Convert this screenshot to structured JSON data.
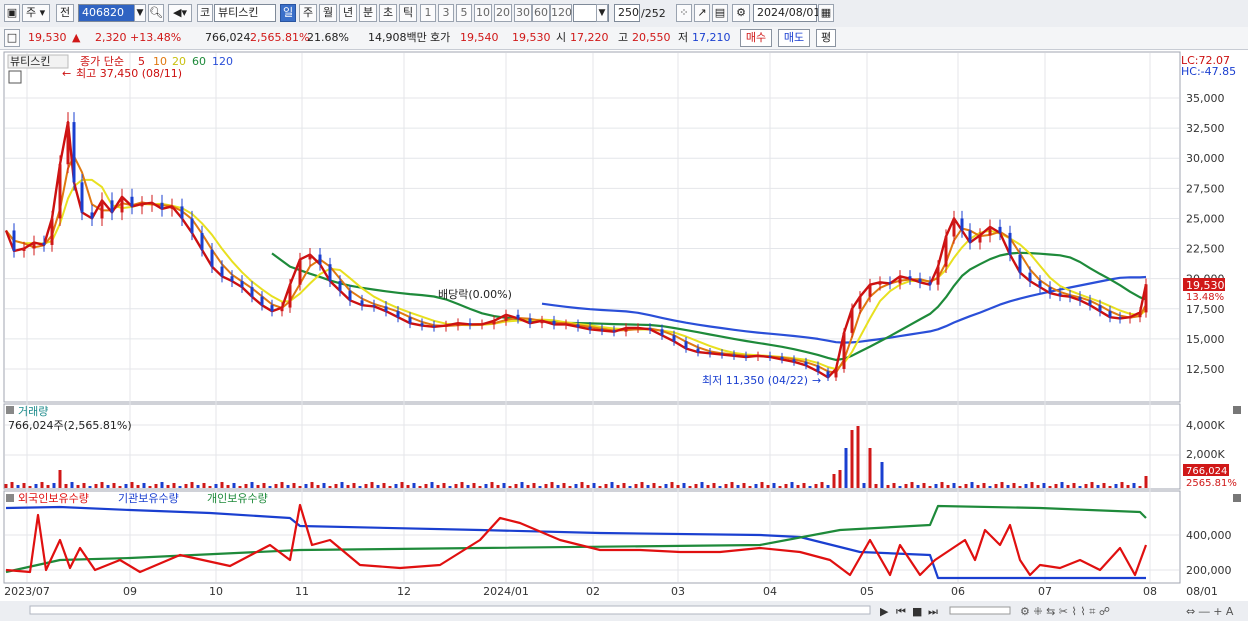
{
  "toolbar": {
    "menu_left": "주",
    "prev_label": "전",
    "stock_code": "406820",
    "stock_name": "뷰티스킨",
    "code_prefix": "코",
    "periods": [
      "일",
      "주",
      "월",
      "년",
      "분",
      "초",
      "틱"
    ],
    "active_period": "일",
    "intervals": [
      "1",
      "3",
      "5",
      "10",
      "20",
      "30",
      "60",
      "120"
    ],
    "count_value": "250",
    "count_total": "/252",
    "date_value": "2024/08/01"
  },
  "quote": {
    "price": "19,530",
    "arrow": "▲",
    "change": "2,320",
    "change_pct": "+13.48%",
    "volume": "766,024",
    "vol_ratio": "2,565.81%",
    "turnover": "21.68%",
    "amount": "14,908백만",
    "hoga_label": "호가",
    "bid1": "19,540",
    "bid2": "19,530",
    "open_label": "시",
    "open": "17,220",
    "high_label": "고",
    "high": "20,550",
    "low_label": "저",
    "low": "17,210",
    "buy_button": "매수",
    "sell_button": "매도",
    "eval_button": "평"
  },
  "price_panel": {
    "title": "뷰티스킨",
    "ma_label": "종가 단순",
    "ma_periods": [
      "5",
      "10",
      "20",
      "60",
      "120"
    ],
    "ma_colors": [
      "#cc1010",
      "#e07810",
      "#e8e020",
      "#1e8a3a",
      "#2a4fd8"
    ],
    "high_annotation": "최고 37,450 (08/11)",
    "low_annotation": "최저 11,350 (04/22)",
    "dividend_annotation": "배당락(0.00%)",
    "lc": "LC:72.07",
    "hc": "HC:-47.85",
    "last_price_tag": "19,530",
    "last_pct_tag": "13.48%",
    "y_ticks": [
      "35,000",
      "32,500",
      "30,000",
      "27,500",
      "25,000",
      "22,500",
      "20,000",
      "17,500",
      "15,000",
      "12,500"
    ]
  },
  "volume_panel": {
    "title": "거래량",
    "subtitle": "766,024주(2,565.81%)",
    "y_ticks": [
      "4,000K",
      "2,000K"
    ],
    "last_tag": "766,024",
    "last_pct": "2565.81%"
  },
  "holdings_panel": {
    "series_labels": [
      "외국인보유수량",
      "기관보유수량",
      "개인보유수량"
    ],
    "series_colors": [
      "#e01010",
      "#1a3fd0",
      "#1e8a3a"
    ],
    "y_ticks": [
      "400,000",
      "200,000"
    ]
  },
  "x_axis": {
    "labels": [
      "2023/07",
      "09",
      "10",
      "11",
      "12",
      "2024/01",
      "02",
      "03",
      "04",
      "05",
      "06",
      "07",
      "08",
      "08/01"
    ]
  }
}
